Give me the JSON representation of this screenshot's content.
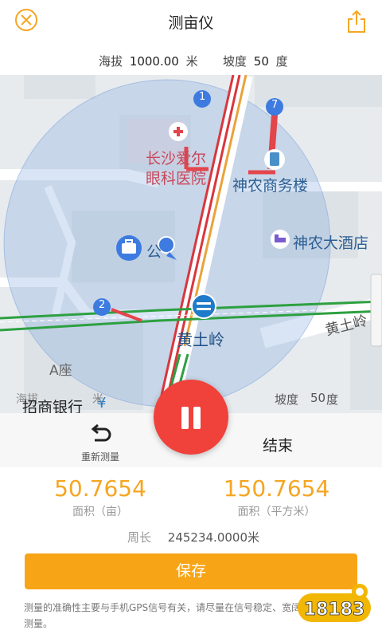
{
  "header": {
    "title": "测亩仪"
  },
  "info": {
    "altitude_label": "海拔",
    "altitude_value": "1000.00",
    "altitude_unit": "米",
    "slope_label": "坡度",
    "slope_value": "50",
    "slope_unit": "度"
  },
  "map": {
    "hospital_line1": "长沙爱尔",
    "hospital_line2": "眼科医院",
    "business_building": "神农商务楼",
    "hotel": "神农大酒店",
    "station": "黄土岭",
    "road": "黄土岭",
    "building_a": "A座",
    "poi_partial": "公",
    "bank": "招商银行",
    "overlay_altitude": "海拔",
    "overlay_altitude_unit": "米",
    "overlay_slope_label": "坡度",
    "overlay_slope_value": "50",
    "overlay_slope_unit": "度",
    "badge_1": "1",
    "badge_2": "2",
    "badge_7": "7"
  },
  "controls": {
    "reset_label": "重新测量",
    "end_label": "结束"
  },
  "results": {
    "area_mu_value": "50.7654",
    "area_mu_label": "面积（亩）",
    "area_m2_value": "150.7654",
    "area_m2_label": "面积（平方米）",
    "perimeter_label": "周长",
    "perimeter_value": "245234.0000米",
    "save_label": "保存",
    "disclaimer": "测量的准确性主要与手机GPS信号有关，请尽量在信号稳定、宽阔的地方进行测量。"
  },
  "watermark": "18183",
  "colors": {
    "accent": "#f5a623",
    "pause": "#f0413a"
  }
}
